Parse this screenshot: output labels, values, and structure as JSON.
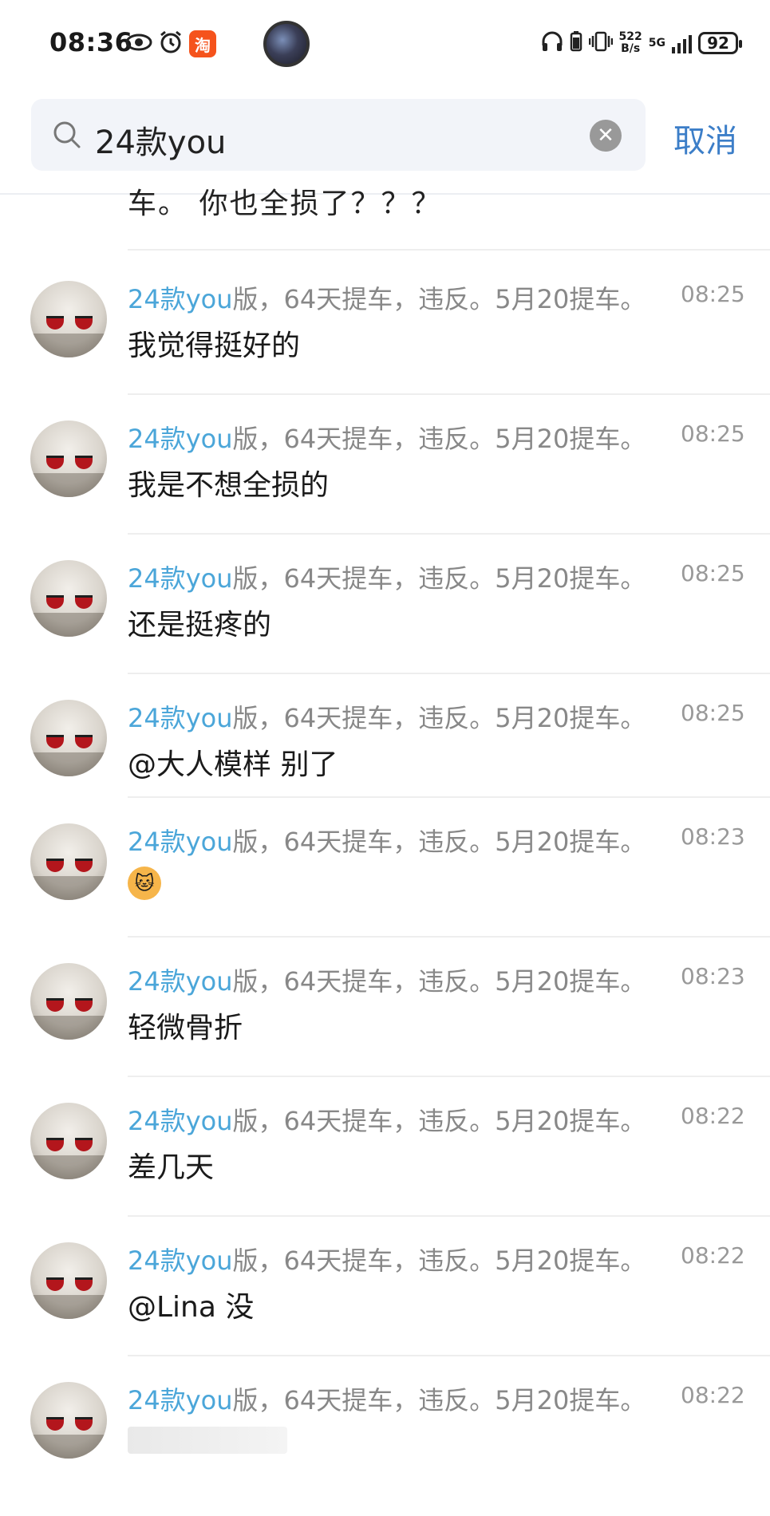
{
  "status_bar": {
    "time": "08:36",
    "icons": [
      "eye-icon",
      "alarm-icon",
      "taobao-icon"
    ],
    "taobao_glyph": "淘",
    "net_speed_value": "522",
    "net_speed_unit": "B/s",
    "network": "5G",
    "battery": "92"
  },
  "search": {
    "query": "24款you",
    "cancel_label": "取消"
  },
  "partial_row": {
    "text": "车。 你也全损了？？？"
  },
  "results": [
    {
      "title_highlight": "24款you",
      "title_rest": "版，64天提车，违反。5月20提车。",
      "time": "08:25",
      "message": "我觉得挺好的"
    },
    {
      "title_highlight": "24款you",
      "title_rest": "版，64天提车，违反。5月20提车。",
      "time": "08:25",
      "message": "我是不想全损的"
    },
    {
      "title_highlight": "24款you",
      "title_rest": "版，64天提车，违反。5月20提车。",
      "time": "08:25",
      "message": "还是挺疼的"
    },
    {
      "title_highlight": "24款you",
      "title_rest": "版，64天提车，违反。5月20提车。",
      "time": "08:25",
      "message": "@大人模样 别了"
    },
    {
      "title_highlight": "24款you",
      "title_rest": "版，64天提车，违反。5月20提车。",
      "time": "08:23",
      "message": "",
      "emoji": "cat-emoji"
    },
    {
      "title_highlight": "24款you",
      "title_rest": "版，64天提车，违反。5月20提车。",
      "time": "08:23",
      "message": "轻微骨折"
    },
    {
      "title_highlight": "24款you",
      "title_rest": "版，64天提车，违反。5月20提车。",
      "time": "08:22",
      "message": "差几天"
    },
    {
      "title_highlight": "24款you",
      "title_rest": "版，64天提车，违反。5月20提车。",
      "time": "08:22",
      "message": "@Lina 没"
    },
    {
      "title_highlight": "24款you",
      "title_rest": "版，64天提车，违反。5月20提车。",
      "time": "08:22",
      "message": ""
    }
  ],
  "colors": {
    "highlight": "#4ba6d9",
    "cancel": "#3c7ec8",
    "muted": "#888888"
  }
}
